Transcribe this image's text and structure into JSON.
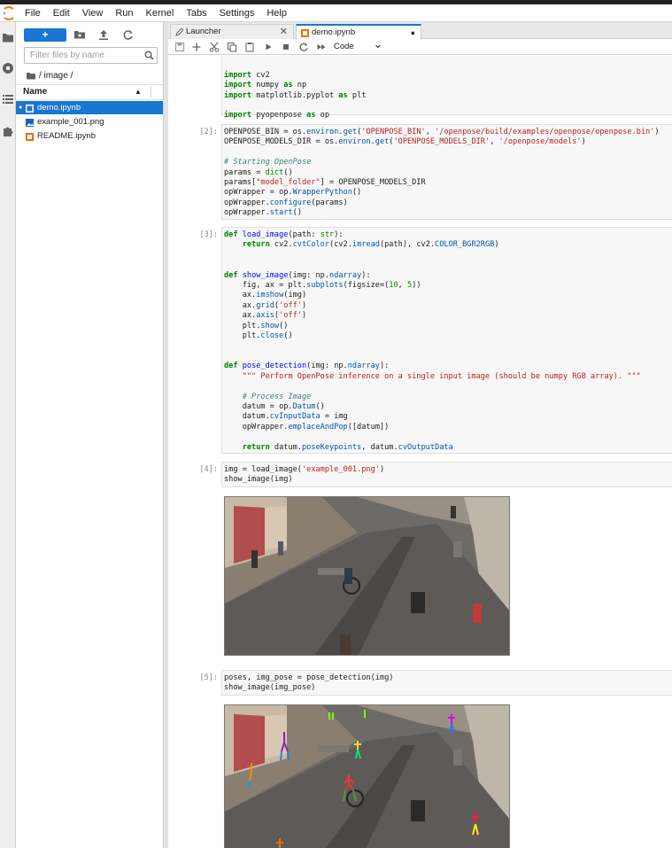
{
  "menubar": {
    "items": [
      "File",
      "Edit",
      "View",
      "Run",
      "Kernel",
      "Tabs",
      "Settings",
      "Help"
    ]
  },
  "filebrowser": {
    "new_label": "+",
    "filter_placeholder": "Filter files by name",
    "breadcrumb": "/ image /",
    "column_name": "Name",
    "files": [
      {
        "name": "demo.ipynb",
        "type": "notebook",
        "selected": true
      },
      {
        "name": "example_001.png",
        "type": "image",
        "selected": false
      },
      {
        "name": "README.ipynb",
        "type": "notebook",
        "selected": false
      }
    ]
  },
  "tabs": [
    {
      "label": "Launcher",
      "active": false
    },
    {
      "label": "demo.ipynb",
      "active": true
    }
  ],
  "toolbar": {
    "cell_type": "Code"
  },
  "cells": {
    "prompt2": "[2]:",
    "prompt3": "[3]:",
    "prompt4": "[4]:",
    "prompt5": "[5]:"
  },
  "colors": {
    "accent": "#1976d2",
    "code_bg": "#f7f7f7",
    "keyword": "#008000",
    "string": "#ba2121",
    "comment": "#408080"
  },
  "icons": [
    "folder-icon",
    "running-icon",
    "toc-icon",
    "extension-icon",
    "new-folder-icon",
    "upload-icon",
    "refresh-icon",
    "search-icon",
    "save-icon",
    "add-cell-icon",
    "cut-icon",
    "copy-icon",
    "paste-icon",
    "run-icon",
    "stop-icon",
    "restart-icon",
    "fast-forward-icon"
  ]
}
